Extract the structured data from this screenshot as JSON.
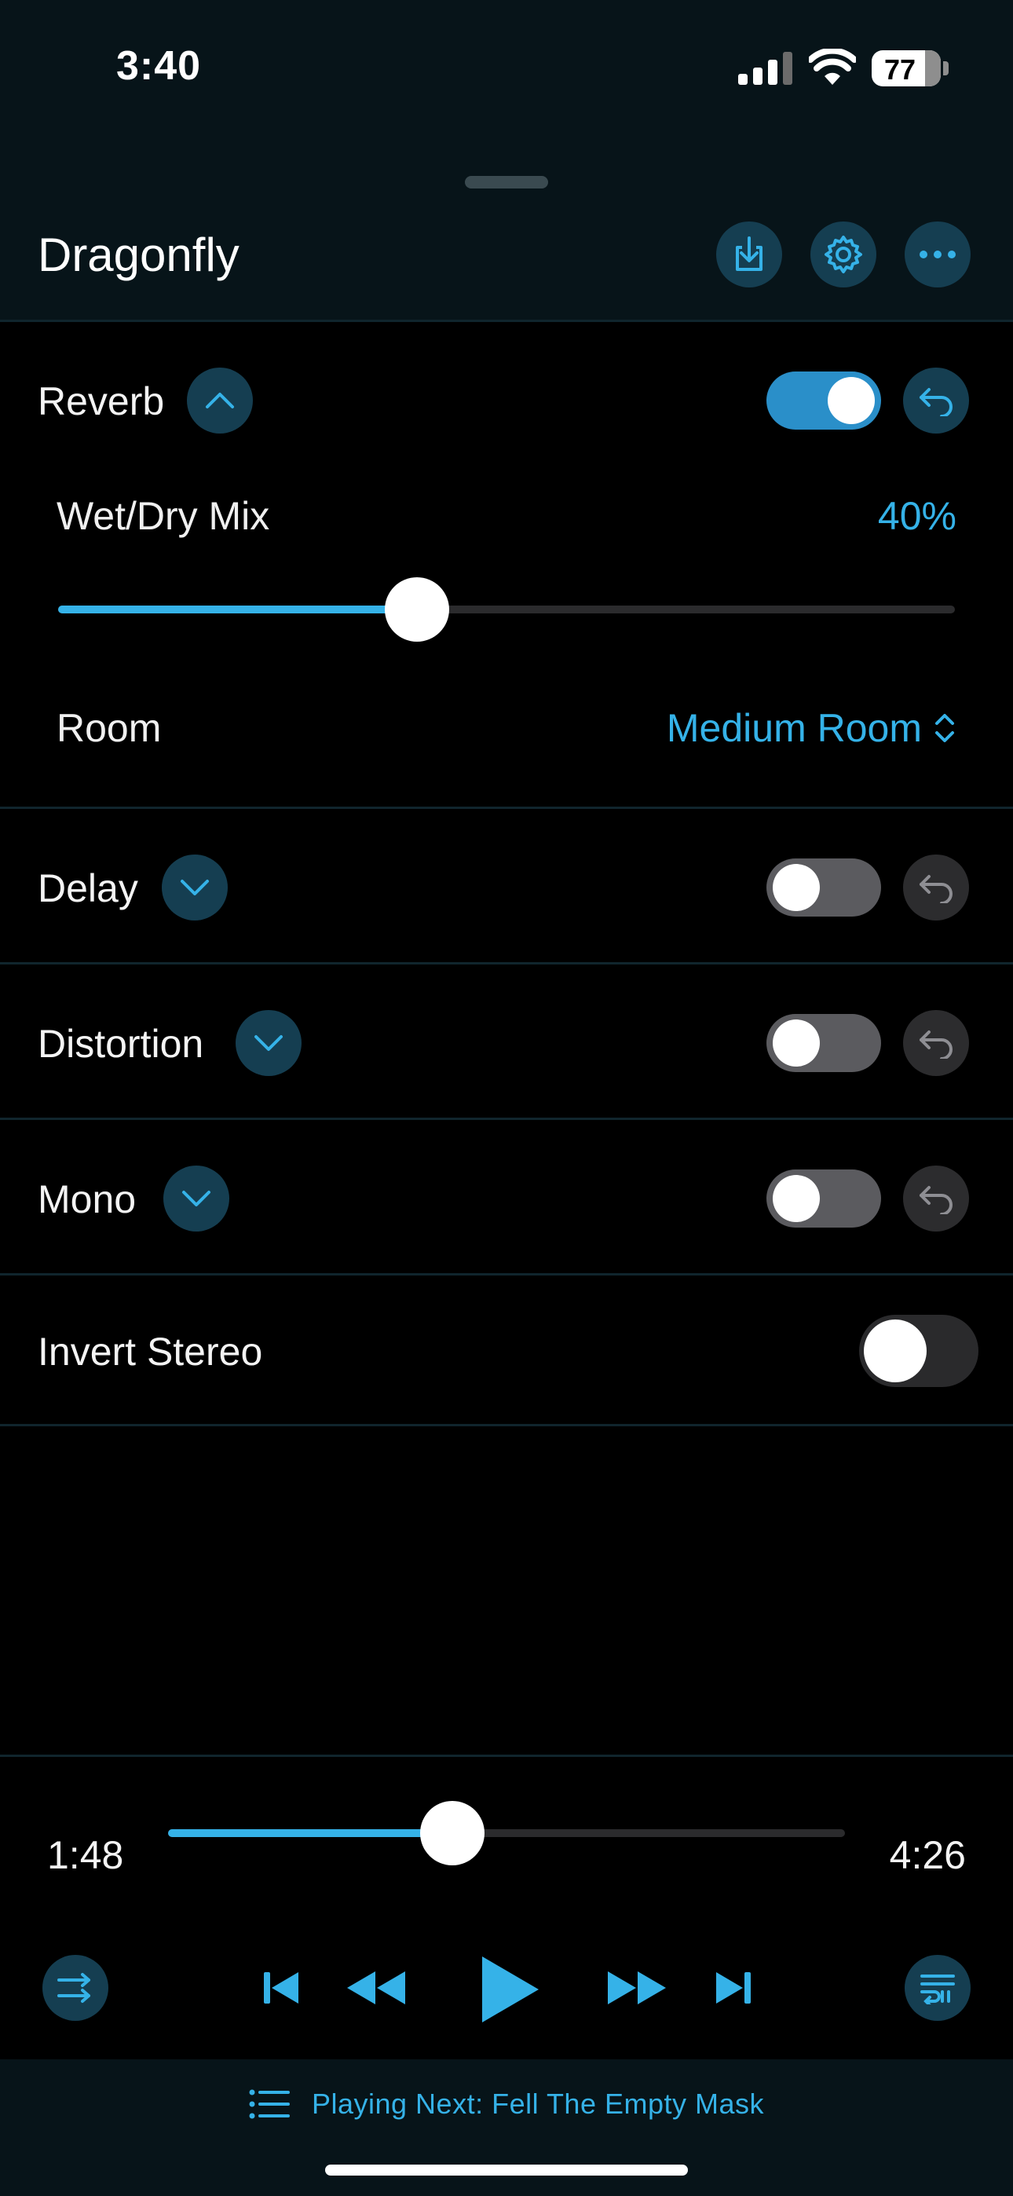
{
  "status_bar": {
    "time": "3:40",
    "battery": "77"
  },
  "header": {
    "title": "Dragonfly"
  },
  "reverb": {
    "label": "Reverb",
    "enabled": true,
    "wet_dry_label": "Wet/Dry Mix",
    "wet_dry_value": "40%",
    "wet_dry_fraction": 0.4,
    "room_label": "Room",
    "room_value": "Medium Room"
  },
  "delay": {
    "label": "Delay",
    "enabled": false
  },
  "distortion": {
    "label": "Distortion",
    "enabled": false
  },
  "mono": {
    "label": "Mono",
    "enabled": false
  },
  "invert_stereo": {
    "label": "Invert Stereo",
    "enabled": false
  },
  "player": {
    "elapsed": "1:48",
    "duration": "4:26",
    "progress_fraction": 0.42
  },
  "up_next": {
    "text": "Playing Next: Fell The Empty Mask"
  },
  "colors": {
    "accent": "#35b2e8",
    "button_bg": "#153e51",
    "header_bg": "#071419"
  }
}
